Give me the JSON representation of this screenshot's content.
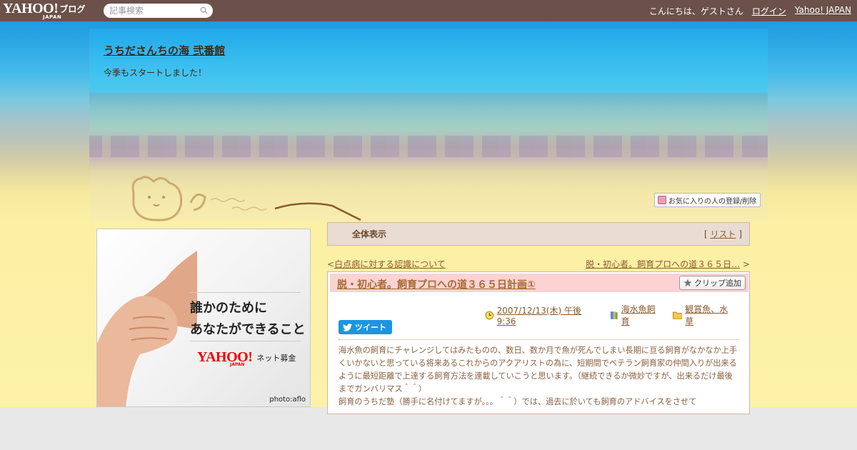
{
  "topbar": {
    "logo_yahoo": "YAHOO!",
    "logo_japan": "JAPAN",
    "logo_blog": "ブログ",
    "search_placeholder": "記事検索",
    "greeting": "こんにちは、ゲストさん",
    "login": "ログイン",
    "yahoo_japan": "Yahoo! JAPAN"
  },
  "header": {
    "title": "うちださんちの海 弐番館",
    "subtitle": "今季もスタートしました！",
    "fav_button": "お気に入りの人の登録/削除"
  },
  "ad": {
    "line1": "誰かのために",
    "line2": "あなたができること",
    "logo_yahoo": "YAHOO!",
    "logo_japan": "JAPAN",
    "logo_text": "ネット募金",
    "credit": "photo:aflo"
  },
  "category": {
    "title": "全体表示",
    "list_open": "[",
    "list_link": "リスト",
    "list_close": "]"
  },
  "pager": {
    "prev_mark": "<",
    "prev": "白点病に対する認識について",
    "next": "脱・初心者。飼育プロへの道３６５日…",
    "next_mark": ">"
  },
  "article": {
    "title": "脱・初心者。飼育プロへの道３６５日計画①",
    "clip_button": "クリップ追加",
    "date": "2007/12/13(木) 午後 9:36",
    "category1": "海水魚飼育",
    "category2": "観賞魚、水草",
    "tweet": "ツイート",
    "body_p1": "海水魚の飼育にチャレンジしてはみたものの、数日、数か月で魚が死んでしまい長期に亘る飼育がなかなか上手くいかないと思っている将来あるこれからのアクアリストの為に、短期間でベテラン飼育家の仲間入りが出来るように最短距離で上達する飼育方法を連載していこうと思います。（継続できるか微妙ですが、出来るだけ最後までガンバリマス＾＾）",
    "body_p2": "飼育のうちだ塾（勝手に名付けてますが。。。＾＾）では、過去に於いても飼育のアドバイスをさせて"
  },
  "colors": {
    "topbar": "#6b5149",
    "title_bar": "#fdd2d2",
    "link": "#8a5a2e",
    "tweet": "#1b95e0"
  }
}
